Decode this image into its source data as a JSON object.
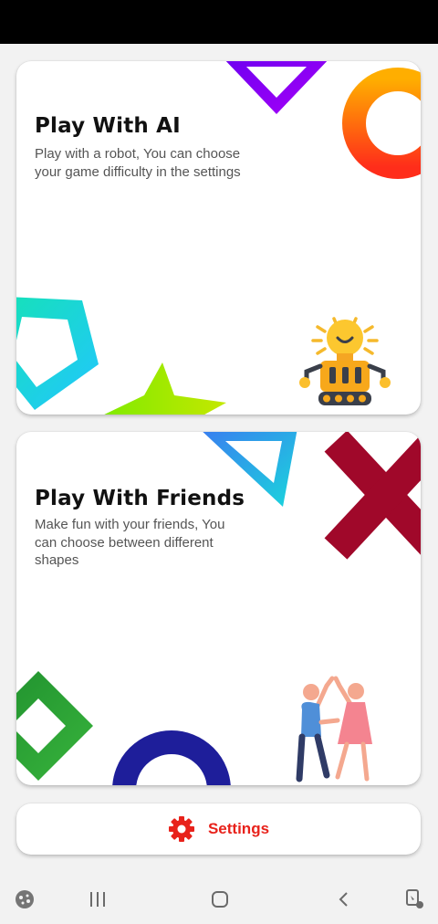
{
  "cards": {
    "play_ai": {
      "title": "Play With AI",
      "description": "Play with a robot, You can choose your game difficulty in the settings"
    },
    "play_friends": {
      "title": "Play With Friends",
      "description": "Make fun with your friends, You can choose between different shapes"
    }
  },
  "settings": {
    "label": "Settings",
    "color": "#e8221b"
  },
  "navigation": {
    "icons": [
      "game-launcher-icon",
      "recent-apps-icon",
      "home-icon",
      "back-icon",
      "screen-capture-icon"
    ]
  },
  "colors": {
    "background": "#f2f2f2",
    "card": "#ffffff",
    "purple_triangle": "#8a00f5",
    "orange_ring": "#ff7a00",
    "cyan_pentagon": "#19d6e0",
    "green_star": "#a4e400",
    "blue_triangle": "#2aaeea",
    "red_cross": "#a0082a",
    "green_diamond": "#2da236",
    "navy_ring": "#1e1e9a"
  }
}
